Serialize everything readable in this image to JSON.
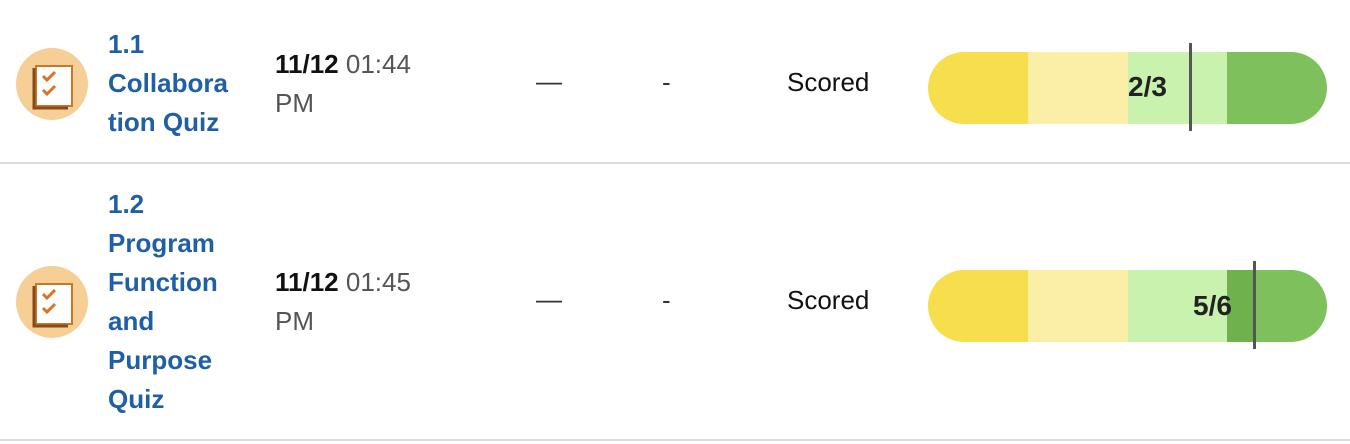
{
  "rows": [
    {
      "title_lines": [
        "1.1",
        "Collabora",
        "tion Quiz"
      ],
      "date": "11/12",
      "time": "01:44",
      "ampm": "PM",
      "col_a": "—",
      "col_b": "-",
      "status": "Scored",
      "score": "2/3",
      "score_fraction": 0.6667
    },
    {
      "title_lines": [
        "1.2",
        "Program",
        "Function",
        "and",
        "Purpose",
        "Quiz"
      ],
      "date": "11/12",
      "time": "01:45",
      "ampm": "PM",
      "col_a": "—",
      "col_b": "-",
      "status": "Scored",
      "score": "5/6",
      "score_fraction": 0.8333
    }
  ],
  "icon": "quiz-checklist-icon",
  "colors": {
    "title": "#1f5fa8",
    "bar_low": "#f7de4c",
    "bar_mid_low": "#fbeea6",
    "bar_mid_high": "#c8f2ae",
    "bar_high": "#7ec05c",
    "icon_bg": "#f5cf95"
  }
}
